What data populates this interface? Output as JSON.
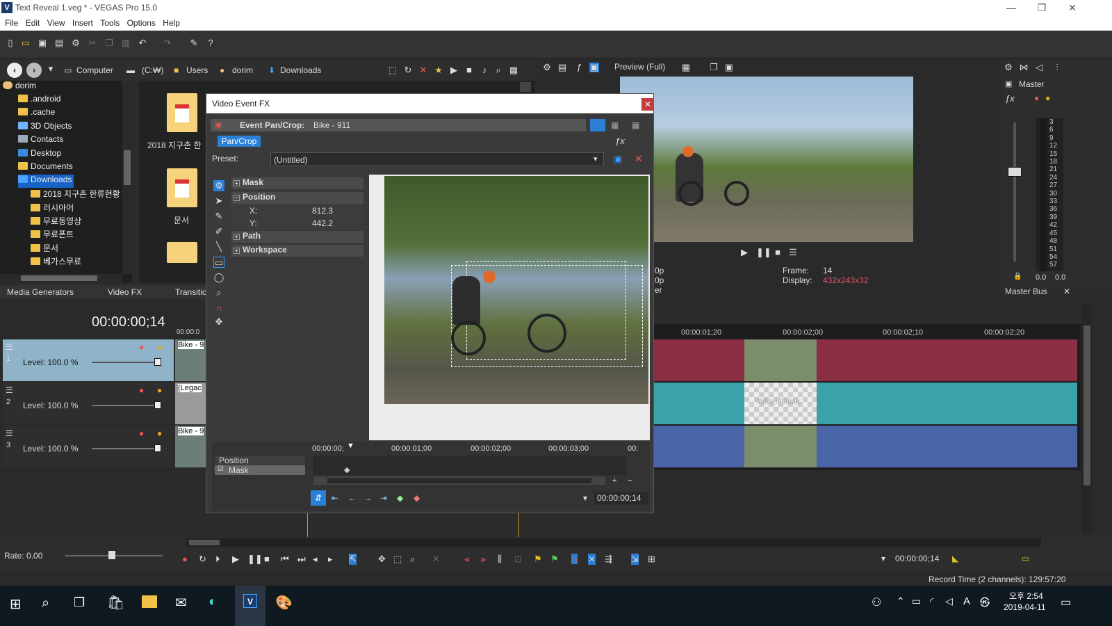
{
  "window": {
    "title": "Text Reveal 1.veg * - VEGAS Pro 15.0",
    "logo": "V",
    "min": "—",
    "max": "❐",
    "close": "✕"
  },
  "menu": [
    "File",
    "Edit",
    "View",
    "Insert",
    "Tools",
    "Options",
    "Help"
  ],
  "breadcrumbs": [
    "Computer",
    "(C:₩)",
    "Users",
    "dorim",
    "Downloads"
  ],
  "tree": {
    "items": [
      {
        "label": "dorim",
        "indent": 0
      },
      {
        "label": ".android",
        "indent": 1
      },
      {
        "label": ".cache",
        "indent": 1
      },
      {
        "label": "3D Objects",
        "indent": 1
      },
      {
        "label": "Contacts",
        "indent": 1
      },
      {
        "label": "Desktop",
        "indent": 1
      },
      {
        "label": "Documents",
        "indent": 1
      },
      {
        "label": "Downloads",
        "indent": 1,
        "selected": true
      },
      {
        "label": "2018 지구촌 한류현황",
        "indent": 2
      },
      {
        "label": "러시아어",
        "indent": 2
      },
      {
        "label": "무료동영상",
        "indent": 2
      },
      {
        "label": "무료폰트",
        "indent": 2
      },
      {
        "label": "문서",
        "indent": 2
      },
      {
        "label": "베가스무료",
        "indent": 2
      }
    ]
  },
  "files": [
    {
      "label": "2018 지구촌 한"
    },
    {
      "label": "문서"
    }
  ],
  "panel_tabs": [
    "Media Generators",
    "Video FX",
    "Transitio"
  ],
  "preview": {
    "label": "Preview (Full)",
    "frame_label": "Frame:",
    "frame": "14",
    "display_label": "Display:",
    "display": "432x243x32",
    "p1": "0p",
    "p2": "0p",
    "tab_cut": "er"
  },
  "master": {
    "label": "Master",
    "bus_label": "Master Bus",
    "left": "0.0",
    "right": "0.0",
    "scale": [
      "3",
      "6",
      "9",
      "12",
      "15",
      "18",
      "21",
      "24",
      "27",
      "30",
      "33",
      "36",
      "39",
      "42",
      "45",
      "48",
      "51",
      "54",
      "57"
    ]
  },
  "timecode": "00:00:00;14",
  "tracks": [
    {
      "num": "1",
      "level": "Level: 100.0 %",
      "clip": "Bike - 9",
      "color": "#8fb3c8"
    },
    {
      "num": "2",
      "level": "Level: 100.0 %",
      "clip": "(Legac",
      "color": "#2e2e2e"
    },
    {
      "num": "3",
      "level": "Level: 100.0 %",
      "clip": "Bike - 9",
      "color": "#2e2e2e"
    }
  ],
  "ruler_marks": [
    "00:00:01;20",
    "00:00:02;00",
    "00:00:02;10",
    "00:00:02;20"
  ],
  "ruler_left": "00:00:0",
  "text_clip": "Hello, Friends",
  "dialog": {
    "title": "Video Event FX",
    "event_label": "Event Pan/Crop:",
    "event_name": "Bike - 911",
    "chain": "Pan/Crop",
    "preset_label": "Preset:",
    "preset_value": "(Untitled)",
    "props": [
      {
        "label": "Mask",
        "type": "header"
      },
      {
        "label": "Position",
        "type": "header"
      },
      {
        "label": "X:",
        "value": "812.3"
      },
      {
        "label": "Y:",
        "value": "442.2"
      },
      {
        "label": "Path",
        "type": "header"
      },
      {
        "label": "Workspace",
        "type": "header"
      }
    ],
    "kf_ruler": [
      "00:00:00;",
      "00:00:01;00",
      "00:00:02;00",
      "00:00:03;00",
      "00:"
    ],
    "kf_tracks": [
      "Position",
      "Mask"
    ],
    "kf_time": "00:00:00;14"
  },
  "rate": "Rate: 0.00",
  "bottom_time": "00:00:00;14",
  "record_time": "Record Time (2 channels): 129:57:20",
  "clock": {
    "time": "오후 2:54",
    "date": "2019-04-11"
  },
  "ime": "A",
  "ime2": "㉿"
}
